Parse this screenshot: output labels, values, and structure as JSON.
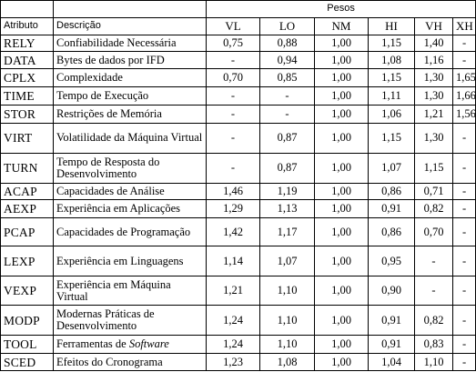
{
  "headers": {
    "attribute": "Atributo",
    "description": "Descrição",
    "weights": "Pesos",
    "levels": [
      "VL",
      "LO",
      "NM",
      "HI",
      "VH",
      "XH"
    ]
  },
  "rows": [
    {
      "attr": "RELY",
      "desc": "Confiabilidade Necessária",
      "vals": [
        "0,75",
        "0,88",
        "1,00",
        "1,15",
        "1,40",
        "-"
      ]
    },
    {
      "attr": "DATA",
      "desc": "Bytes de dados por  IFD",
      "vals": [
        "-",
        "0,94",
        "1,00",
        "1,08",
        "1,16",
        "-"
      ]
    },
    {
      "attr": "CPLX",
      "desc": "Complexidade",
      "vals": [
        "0,70",
        "0,85",
        "1,00",
        "1,15",
        "1,30",
        "1,65"
      ]
    },
    {
      "attr": "TIME",
      "desc": "Tempo de Execução",
      "vals": [
        "-",
        "-",
        "1,00",
        "1,11",
        "1,30",
        "1,66"
      ]
    },
    {
      "attr": "STOR",
      "desc": "Restrições de Memória",
      "vals": [
        "-",
        "-",
        "1,00",
        "1,06",
        "1,21",
        "1,56"
      ]
    },
    {
      "attr": "VIRT",
      "desc": "Volatilidade da Máquina Virtual",
      "vals": [
        "-",
        "0,87",
        "1,00",
        "1,15",
        "1,30",
        "-"
      ]
    },
    {
      "attr": "TURN",
      "desc": "Tempo de Resposta do Desenvolvimento",
      "vals": [
        "-",
        "0,87",
        "1,00",
        "1,07",
        "1,15",
        "-"
      ]
    },
    {
      "attr": "ACAP",
      "desc": "Capacidades de Análise",
      "vals": [
        "1,46",
        "1,19",
        "1,00",
        "0,86",
        "0,71",
        "-"
      ]
    },
    {
      "attr": "AEXP",
      "desc": "Experiência em Aplicações",
      "vals": [
        "1,29",
        "1,13",
        "1,00",
        "0,91",
        "0,82",
        "-"
      ]
    },
    {
      "attr": "PCAP",
      "desc": "Capacidades de Programação",
      "vals": [
        "1,42",
        "1,17",
        "1,00",
        "0,86",
        "0,70",
        "-"
      ]
    },
    {
      "attr": "LEXP",
      "desc": "Experiência em Linguagens",
      "vals": [
        "1,14",
        "1,07",
        "1,00",
        "0,95",
        "-",
        "-"
      ]
    },
    {
      "attr": "VEXP",
      "desc": "Experiência em Máquina Virtual",
      "vals": [
        "1,21",
        "1,10",
        "1,00",
        "0,90",
        "-",
        "-"
      ]
    },
    {
      "attr": "MODP",
      "desc": "Modernas Práticas de Desenvolvimento",
      "vals": [
        "1,24",
        "1,10",
        "1,00",
        "0,91",
        "0,82",
        "-"
      ]
    },
    {
      "attr": "TOOL",
      "desc_pre": "Ferramentas de ",
      "desc_italic": "Software",
      "vals": [
        "1,24",
        "1,10",
        "1,00",
        "0,91",
        "0,83",
        "-"
      ]
    },
    {
      "attr": "SCED",
      "desc": "Efeitos do Cronograma",
      "vals": [
        "1,23",
        "1,08",
        "1,00",
        "1,04",
        "1,10",
        "-"
      ]
    }
  ]
}
